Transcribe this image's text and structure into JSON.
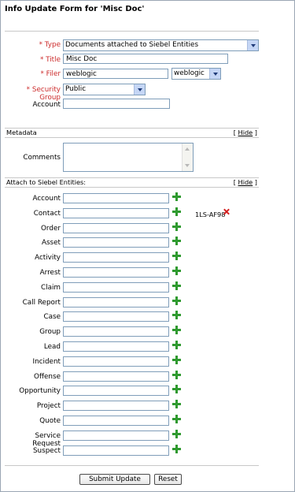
{
  "form": {
    "title": "Info Update Form for 'Misc Doc'",
    "required_mark": "*",
    "type_label": "Type",
    "type_value": "Documents attached to Siebel Entities",
    "title_label": "Title",
    "title_value": "Misc Doc",
    "filer_label": "Filer",
    "filer_value": "weblogic",
    "filer_select_value": "weblogic",
    "security_label": "Security Group",
    "security_value": "Public",
    "account_label": "Account",
    "account_value": ""
  },
  "metadata": {
    "section_title": "Metadata",
    "hide_label": "Hide",
    "comments_label": "Comments",
    "comments_value": ""
  },
  "attach": {
    "section_title": "Attach to Siebel Entities:",
    "hide_label": "Hide",
    "entities": [
      {
        "label": "Account",
        "value": "",
        "attached": ""
      },
      {
        "label": "Contact",
        "value": "",
        "attached": "1LS-AF98"
      },
      {
        "label": "Order",
        "value": "",
        "attached": ""
      },
      {
        "label": "Asset",
        "value": "",
        "attached": ""
      },
      {
        "label": "Activity",
        "value": "",
        "attached": ""
      },
      {
        "label": "Arrest",
        "value": "",
        "attached": ""
      },
      {
        "label": "Claim",
        "value": "",
        "attached": ""
      },
      {
        "label": "Call Report",
        "value": "",
        "attached": ""
      },
      {
        "label": "Case",
        "value": "",
        "attached": ""
      },
      {
        "label": "Group",
        "value": "",
        "attached": ""
      },
      {
        "label": "Lead",
        "value": "",
        "attached": ""
      },
      {
        "label": "Incident",
        "value": "",
        "attached": ""
      },
      {
        "label": "Offense",
        "value": "",
        "attached": ""
      },
      {
        "label": "Opportunity",
        "value": "",
        "attached": ""
      },
      {
        "label": "Project",
        "value": "",
        "attached": ""
      },
      {
        "label": "Quote",
        "value": "",
        "attached": ""
      },
      {
        "label": "Service Request",
        "value": "",
        "attached": ""
      },
      {
        "label": "Suspect",
        "value": "",
        "attached": ""
      }
    ]
  },
  "buttons": {
    "submit": "Submit Update",
    "reset": "Reset"
  },
  "colors": {
    "required": "#cc2b2b",
    "add_icon": "#2f9a2f",
    "remove_icon": "#d42020",
    "input_border": "#7f9db9"
  }
}
